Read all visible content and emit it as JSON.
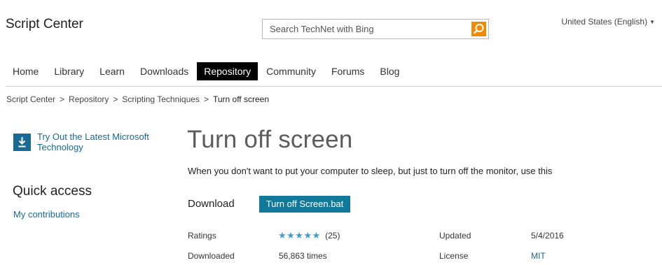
{
  "header": {
    "site_title": "Script Center",
    "search_placeholder": "Search TechNet with Bing",
    "search_icon": "search-icon",
    "locale": "United States (English)",
    "accent_color": "#f18a00"
  },
  "nav": {
    "items": [
      {
        "label": "Home"
      },
      {
        "label": "Library"
      },
      {
        "label": "Learn"
      },
      {
        "label": "Downloads"
      },
      {
        "label": "Repository",
        "active": true
      },
      {
        "label": "Community"
      },
      {
        "label": "Forums"
      },
      {
        "label": "Blog"
      }
    ]
  },
  "breadcrumb": {
    "items": [
      "Script Center",
      "Repository",
      "Scripting Techniques",
      "Turn off screen"
    ],
    "separator": ">"
  },
  "sidebar": {
    "promo_text": "Try Out the Latest Microsoft Technology",
    "promo_icon": "download-icon",
    "quick_access_heading": "Quick access",
    "my_contributions": "My contributions"
  },
  "main": {
    "title": "Turn off screen",
    "description": "When you don't want to put your computer to sleep, but just to turn off the monitor, use this",
    "download_label": "Download",
    "download_button": "Turn off Screen.bat",
    "ratings_label": "Ratings",
    "ratings_stars": "★★★★★",
    "rating_value": 5,
    "ratings_count": "(25)",
    "downloaded_label": "Downloaded",
    "downloaded_value": "56,863 times",
    "updated_label": "Updated",
    "updated_value": "5/4/2016",
    "license_label": "License",
    "license_value": "MIT"
  }
}
